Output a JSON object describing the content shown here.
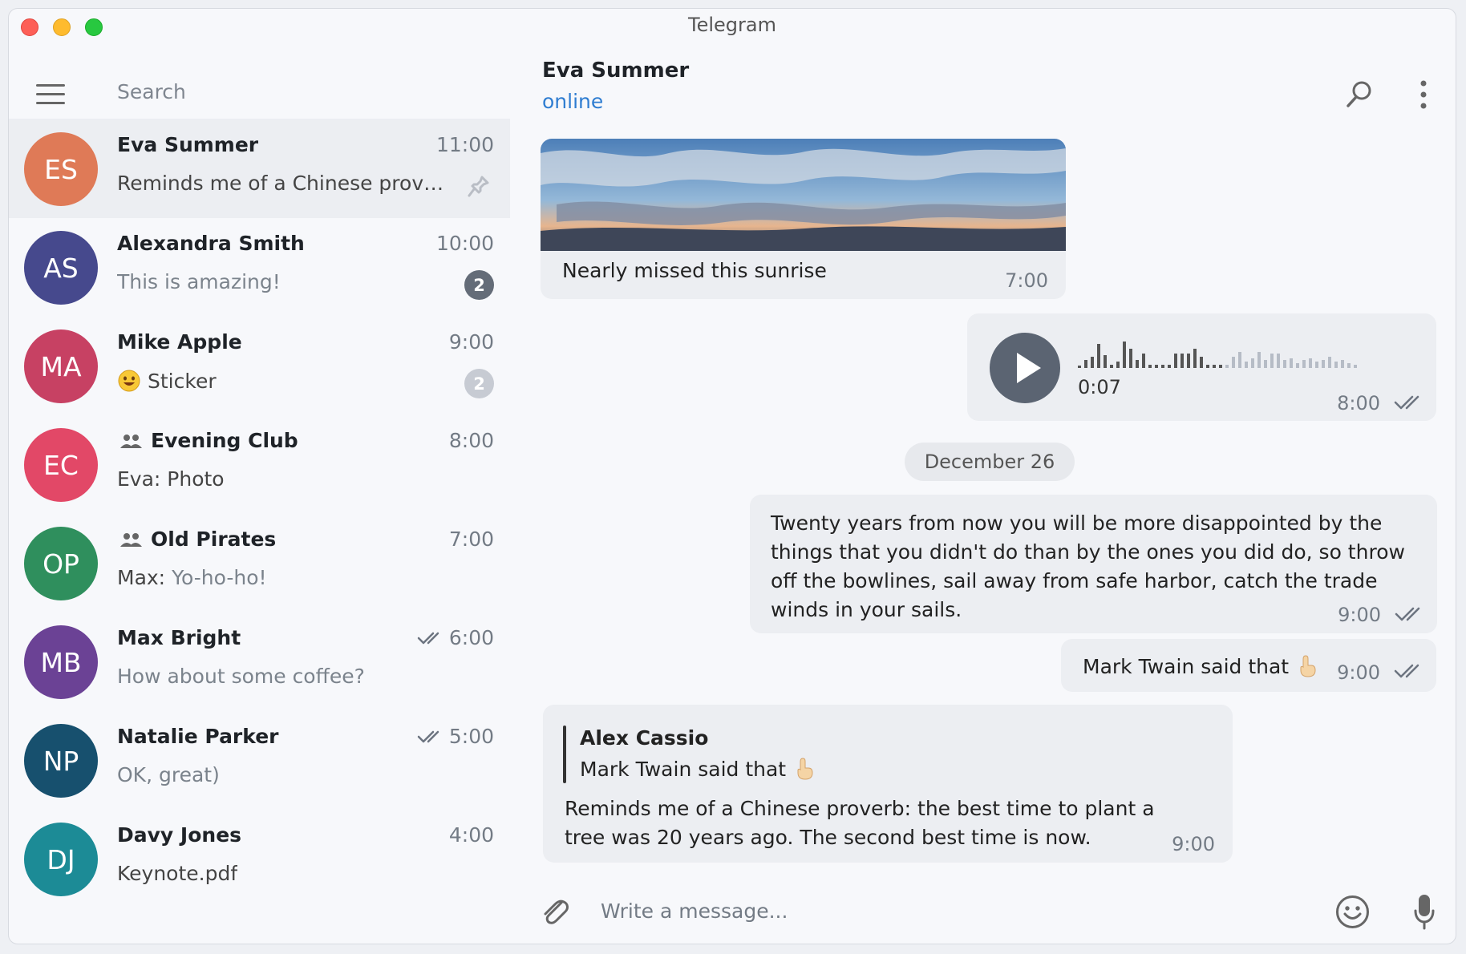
{
  "window": {
    "title": "Telegram"
  },
  "sidebar": {
    "search_placeholder": "Search",
    "chats": [
      {
        "initials": "ES",
        "name": "Eva Summer",
        "time": "11:00",
        "preview": "Reminds me of a Chinese prover...",
        "color": "#df7a57",
        "pinned": true
      },
      {
        "initials": "AS",
        "name": "Alexandra Smith",
        "time": "10:00",
        "preview": "This is amazing!",
        "badge": "2",
        "color": "#46498d"
      },
      {
        "initials": "MA",
        "name": "Mike Apple",
        "time": "9:00",
        "preview": "Sticker",
        "badge": "2",
        "color": "#c74163",
        "emoji": "smiling-face-icon"
      },
      {
        "initials": "EC",
        "name": "Evening Club",
        "time": "8:00",
        "preview": "Eva: Photo",
        "color": "#e24867",
        "group": true
      },
      {
        "initials": "OP",
        "name": "Old Pirates",
        "time": "7:00",
        "preview_prefix": "Max:",
        "preview": "Yo-ho-ho!",
        "color": "#2f8f5d",
        "group": true
      },
      {
        "initials": "MB",
        "name": "Max Bright",
        "time": "6:00",
        "preview": "How about some coffee?",
        "color": "#6b4295",
        "read": true
      },
      {
        "initials": "NP",
        "name": "Natalie Parker",
        "time": "5:00",
        "preview": "OK, great)",
        "color": "#17506e",
        "read": true
      },
      {
        "initials": "DJ",
        "name": "Davy Jones",
        "time": "4:00",
        "preview": "Keynote.pdf",
        "color": "#1c8b96"
      }
    ]
  },
  "chat": {
    "name": "Eva Summer",
    "status": "online",
    "messages": {
      "photo": {
        "caption": "Nearly missed this sunrise",
        "time": "7:00"
      },
      "voice": {
        "duration": "0:07",
        "time": "8:00"
      },
      "date": "December 26",
      "quote": {
        "text": "Twenty years from now you will be more disappointed by the things that you didn't do than by the ones you did do, so throw off the bowlines, sail away from safe harbor, catch the trade winds in your sails.",
        "time": "9:00"
      },
      "short": {
        "text": "Mark Twain said that",
        "time": "9:00"
      },
      "reply": {
        "author": "Alex Cassio",
        "quote": "Mark Twain said that",
        "text": "Reminds me of a Chinese proverb: the best time to plant a tree was 20 years ago. The second best time is now.",
        "time": "9:00"
      }
    },
    "composer_placeholder": "Write a message..."
  },
  "colors": {
    "accent": "#2f7dd1",
    "bubble": "#eceef2",
    "active_chat": "#eceef2"
  },
  "icons": [
    "menu-icon",
    "search-icon",
    "more-vertical-icon",
    "pin-icon",
    "group-icon",
    "double-check-icon",
    "play-icon",
    "paperclip-icon",
    "smile-icon",
    "microphone-icon",
    "pointing-up-icon"
  ]
}
